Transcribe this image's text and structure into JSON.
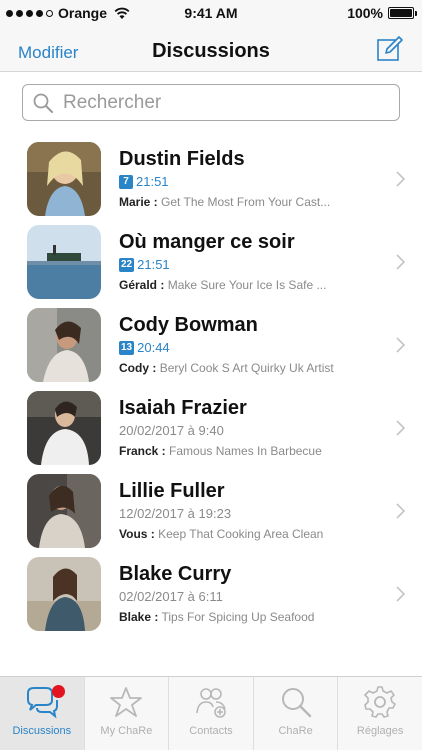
{
  "status_bar": {
    "carrier": "Orange",
    "time": "9:41 AM",
    "battery": "100%"
  },
  "nav": {
    "edit_label": "Modifier",
    "title": "Discussions",
    "compose_icon": "compose-icon"
  },
  "search": {
    "placeholder": "Rechercher"
  },
  "conversations": [
    {
      "name": "Dustin Fields",
      "badge": "7",
      "time": "21:51",
      "unread": true,
      "sender": "Marie :",
      "message": "Get The Most From Your Cast..."
    },
    {
      "name": "Où manger ce soir",
      "badge": "22",
      "time": "21:51",
      "unread": true,
      "sender": "Gérald :",
      "message": "Make Sure Your Ice Is Safe ..."
    },
    {
      "name": "Cody Bowman",
      "badge": "13",
      "time": "20:44",
      "unread": true,
      "sender": "Cody :",
      "message": "Beryl Cook S Art Quirky Uk Artist"
    },
    {
      "name": "Isaiah Frazier",
      "badge": "",
      "time": "20/02/2017 à 9:40",
      "unread": false,
      "sender": "Franck :",
      "message": "Famous Names In Barbecue"
    },
    {
      "name": "Lillie Fuller",
      "badge": "",
      "time": "12/02/2017 à 19:23",
      "unread": false,
      "sender": "Vous :",
      "message": "Keep That Cooking Area Clean"
    },
    {
      "name": "Blake Curry",
      "badge": "",
      "time": "02/02/2017 à 6:11",
      "unread": false,
      "sender": "Blake :",
      "message": "Tips For Spicing Up Seafood"
    }
  ],
  "tabs": [
    {
      "label": "Discussions",
      "icon": "chat-bubbles-icon",
      "active": true
    },
    {
      "label": "My ChaRe",
      "icon": "star-icon",
      "active": false
    },
    {
      "label": "Contacts",
      "icon": "add-contact-icon",
      "active": false
    },
    {
      "label": "ChaRe",
      "icon": "search-icon",
      "active": false
    },
    {
      "label": "Réglages",
      "icon": "gear-icon",
      "active": false
    }
  ],
  "colors": {
    "accent": "#2a84c8",
    "notification": "#e3141f",
    "muted": "#8a8a8a"
  }
}
